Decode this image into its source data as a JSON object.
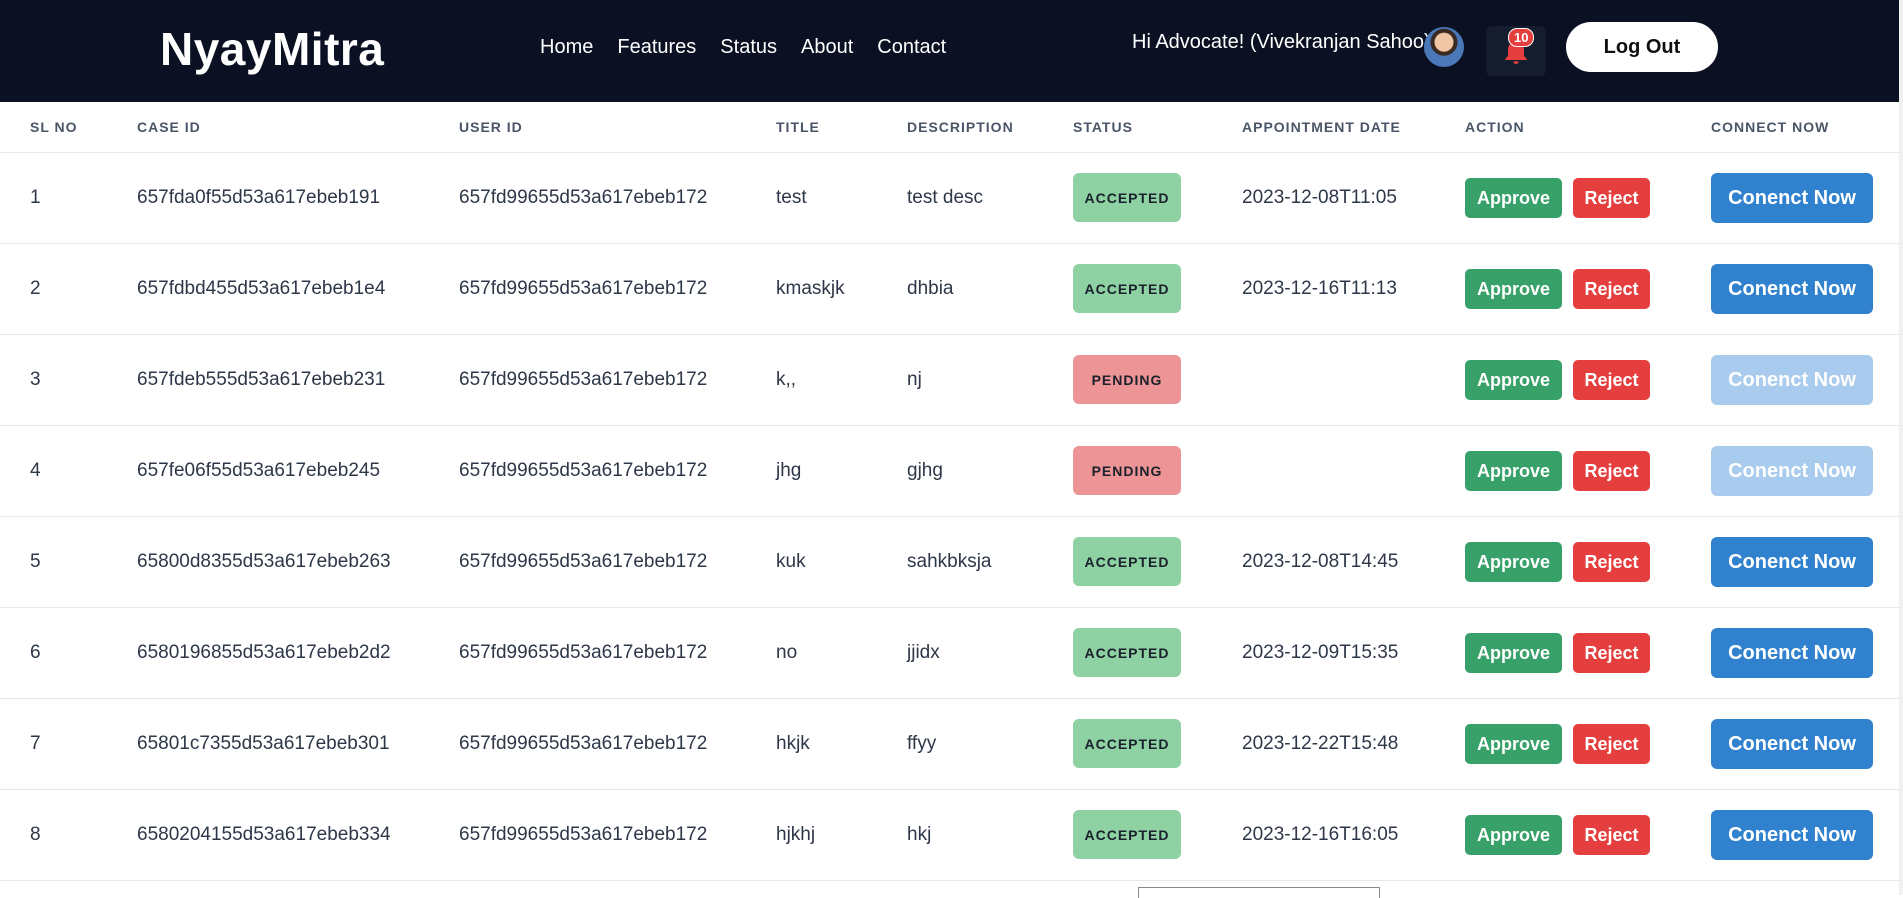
{
  "nav": {
    "brand": "NyayMitra",
    "links": [
      "Home",
      "Features",
      "Status",
      "About",
      "Contact"
    ],
    "greeting": "Hi Advocate! (Vivekranjan Sahoo)",
    "notification_count": "10",
    "logout_label": "Log Out"
  },
  "table": {
    "headers": [
      "SL NO",
      "CASE ID",
      "USER ID",
      "TITLE",
      "DESCRIPTION",
      "STATUS",
      "APPOINTMENT DATE",
      "ACTION",
      "CONNECT NOW"
    ],
    "rows": [
      {
        "sl": "1",
        "case_id": "657fda0f55d53a617ebeb191",
        "user_id": "657fd99655d53a617ebeb172",
        "title": "test",
        "description": "test desc",
        "status": "ACCEPTED",
        "date": "2023-12-08T11:05",
        "approve": "Approve",
        "reject": "Reject",
        "connect": "Conenct Now"
      },
      {
        "sl": "2",
        "case_id": "657fdbd455d53a617ebeb1e4",
        "user_id": "657fd99655d53a617ebeb172",
        "title": "kmaskjk",
        "description": "dhbia",
        "status": "ACCEPTED",
        "date": "2023-12-16T11:13",
        "approve": "Approve",
        "reject": "Reject",
        "connect": "Conenct Now"
      },
      {
        "sl": "3",
        "case_id": "657fdeb555d53a617ebeb231",
        "user_id": "657fd99655d53a617ebeb172",
        "title": "k,,",
        "description": "nj",
        "status": "PENDING",
        "date": "",
        "approve": "Approve",
        "reject": "Reject",
        "connect": "Conenct Now"
      },
      {
        "sl": "4",
        "case_id": "657fe06f55d53a617ebeb245",
        "user_id": "657fd99655d53a617ebeb172",
        "title": "jhg",
        "description": "gjhg",
        "status": "PENDING",
        "date": "",
        "approve": "Approve",
        "reject": "Reject",
        "connect": "Conenct Now"
      },
      {
        "sl": "5",
        "case_id": "65800d8355d53a617ebeb263",
        "user_id": "657fd99655d53a617ebeb172",
        "title": "kuk",
        "description": "sahkbksja",
        "status": "ACCEPTED",
        "date": "2023-12-08T14:45",
        "approve": "Approve",
        "reject": "Reject",
        "connect": "Conenct Now"
      },
      {
        "sl": "6",
        "case_id": "6580196855d53a617ebeb2d2",
        "user_id": "657fd99655d53a617ebeb172",
        "title": "no",
        "description": "jjidx",
        "status": "ACCEPTED",
        "date": "2023-12-09T15:35",
        "approve": "Approve",
        "reject": "Reject",
        "connect": "Conenct Now"
      },
      {
        "sl": "7",
        "case_id": "65801c7355d53a617ebeb301",
        "user_id": "657fd99655d53a617ebeb172",
        "title": "hkjk",
        "description": "ffyy",
        "status": "ACCEPTED",
        "date": "2023-12-22T15:48",
        "approve": "Approve",
        "reject": "Reject",
        "connect": "Conenct Now"
      },
      {
        "sl": "8",
        "case_id": "6580204155d53a617ebeb334",
        "user_id": "657fd99655d53a617ebeb172",
        "title": "hjkhj",
        "description": "hkj",
        "status": "ACCEPTED",
        "date": "2023-12-16T16:05",
        "approve": "Approve",
        "reject": "Reject",
        "connect": "Conenct Now"
      }
    ]
  },
  "colors": {
    "navbar_bg": "#0b1122",
    "accepted": "#8ed1a2",
    "pending": "#ed9496",
    "approve": "#38a169",
    "reject": "#e53e3e",
    "connect": "#3182ce",
    "connect_disabled": "#a9cbee"
  },
  "icons": {
    "notification": "bell-icon",
    "avatar": "user-avatar"
  }
}
